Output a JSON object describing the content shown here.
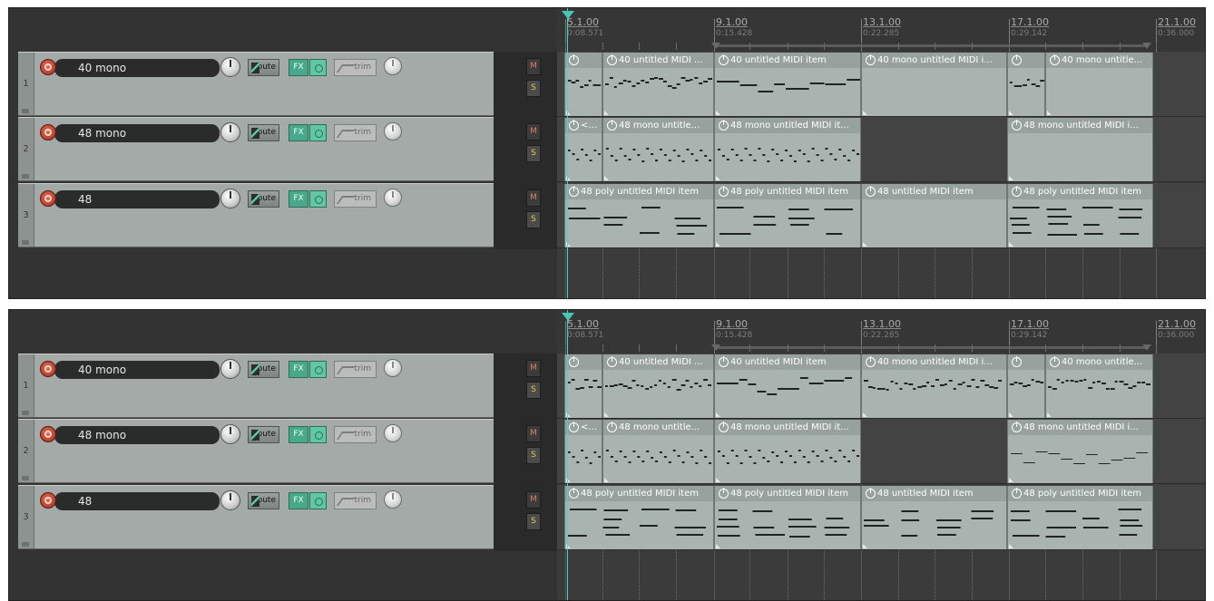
{
  "ruler": {
    "marks": [
      {
        "label": "5.1.00",
        "time": "0:08.571"
      },
      {
        "label": "9.1.00",
        "time": "0:15.428"
      },
      {
        "label": "13.1.00",
        "time": "0:22.285"
      },
      {
        "label": "17.1.00",
        "time": "0:29.142"
      },
      {
        "label": "21.1.00",
        "time": "0:36.000"
      }
    ]
  },
  "icons": {
    "record_arm": "record-arm-icon",
    "route": "route-icon",
    "fx_bypass": "fx-bypass-icon",
    "trim": "envelope-icon",
    "item": "power-icon",
    "folder": "folder-icon"
  },
  "colors": {
    "fx_active": "#47a98a",
    "playhead": "#46d6bd",
    "record": "#c44a35"
  },
  "panels": [
    {
      "tracks": [
        {
          "number": "1",
          "name": "40 mono",
          "route_label": "Route",
          "fx_label": "FX",
          "trim_label": "trim",
          "mute_label": "M",
          "solo_label": "S"
        },
        {
          "number": "2",
          "name": "48 mono",
          "route_label": "Route",
          "fx_label": "FX",
          "trim_label": "trim",
          "mute_label": "M",
          "solo_label": "S"
        },
        {
          "number": "3",
          "name": "48",
          "route_label": "Route",
          "fx_label": "FX",
          "trim_label": "trim",
          "mute_label": "M",
          "solo_label": "S"
        }
      ],
      "lanes": [
        {
          "items": [
            {
              "label": "",
              "pattern": "dense"
            },
            {
              "label": "40 untitled MIDI ...",
              "pattern": "dense"
            },
            {
              "label": "40 untitled MIDI item",
              "pattern": "sparse"
            },
            {
              "label": "40 mono untitled MIDI i...",
              "pattern": "empty"
            },
            {
              "label": "",
              "pattern": "dense"
            },
            {
              "label": "40 mono untitle...",
              "pattern": "empty"
            }
          ]
        },
        {
          "items": [
            {
              "label": "<< ...",
              "pattern": "dots"
            },
            {
              "label": "48 mono untitle...",
              "pattern": "dots"
            },
            {
              "label": "48 mono untitled MIDI it...",
              "pattern": "dots"
            },
            {
              "label": "48 mono untitled MIDI i...",
              "pattern": "empty"
            }
          ]
        },
        {
          "items": [
            {
              "label": "48 poly untitled MIDI item",
              "pattern": "poly"
            },
            {
              "label": "48 poly untitled MIDI item",
              "pattern": "poly"
            },
            {
              "label": "48 untitled MIDI item",
              "pattern": "empty"
            },
            {
              "label": "48 poly untitled MIDI item",
              "pattern": "poly"
            }
          ]
        }
      ]
    },
    {
      "tracks": [
        {
          "number": "1",
          "name": "40 mono",
          "route_label": "Route",
          "fx_label": "FX",
          "trim_label": "trim",
          "mute_label": "M",
          "solo_label": "S"
        },
        {
          "number": "2",
          "name": "48 mono",
          "route_label": "Route",
          "fx_label": "FX",
          "trim_label": "trim",
          "mute_label": "M",
          "solo_label": "S"
        },
        {
          "number": "3",
          "name": "48",
          "route_label": "Route",
          "fx_label": "FX",
          "trim_label": "trim",
          "mute_label": "M",
          "solo_label": "S"
        }
      ],
      "lanes": [
        {
          "items": [
            {
              "label": "",
              "pattern": "dense"
            },
            {
              "label": "40 untitled MIDI ...",
              "pattern": "dense"
            },
            {
              "label": "40 untitled MIDI item",
              "pattern": "sparse"
            },
            {
              "label": "40 mono untitled MIDI i...",
              "pattern": "dense"
            },
            {
              "label": "",
              "pattern": "dense"
            },
            {
              "label": "40 mono untitle...",
              "pattern": "dense"
            }
          ]
        },
        {
          "items": [
            {
              "label": "<< ...",
              "pattern": "dots"
            },
            {
              "label": "48 mono untitle...",
              "pattern": "dots"
            },
            {
              "label": "48 mono untitled MIDI it...",
              "pattern": "dots"
            },
            {
              "label": "48 mono untitled MIDI i...",
              "pattern": "steps"
            }
          ]
        },
        {
          "items": [
            {
              "label": "48 poly untitled MIDI item",
              "pattern": "poly"
            },
            {
              "label": "48 poly untitled MIDI item",
              "pattern": "poly"
            },
            {
              "label": "48 untitled MIDI item",
              "pattern": "poly"
            },
            {
              "label": "48 poly untitled MIDI item",
              "pattern": "poly"
            }
          ]
        }
      ]
    }
  ]
}
